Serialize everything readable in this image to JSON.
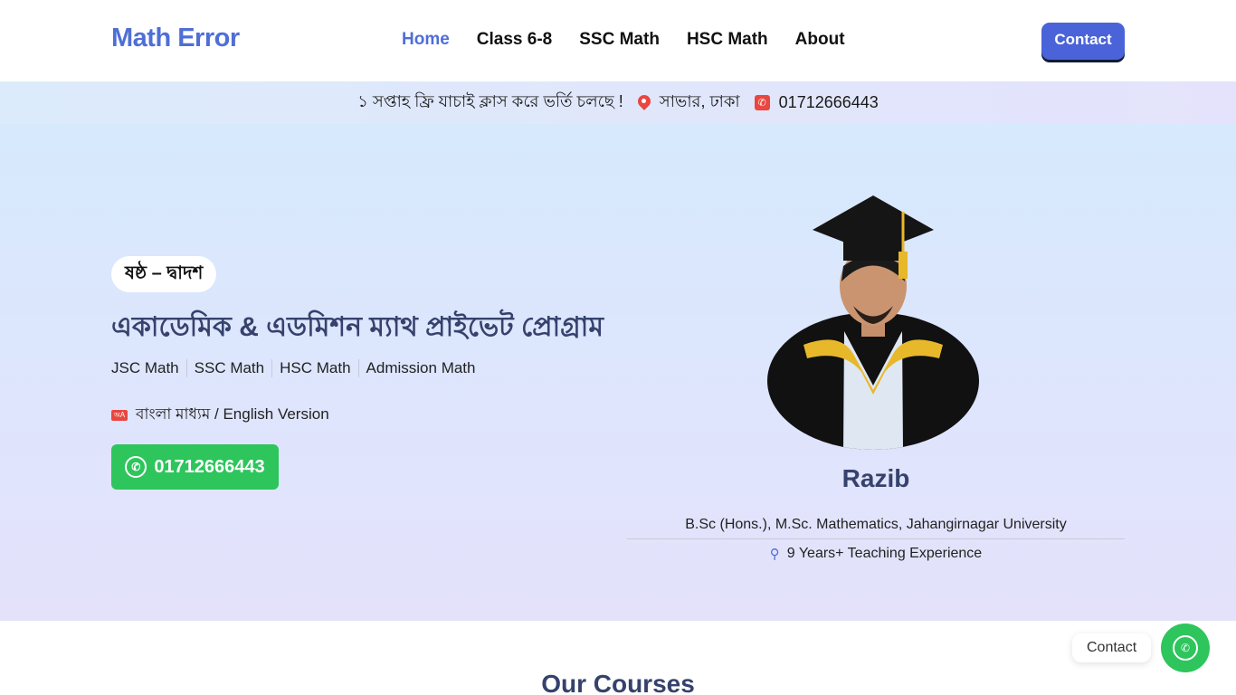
{
  "header": {
    "logo": "Math Error",
    "nav": [
      "Home",
      "Class 6-8",
      "SSC Math",
      "HSC Math",
      "About"
    ],
    "contact_label": "Contact"
  },
  "infobar": {
    "promo": "১ সপ্তাহ ফ্রি যাচাই ক্লাস করে ভর্তি চলছে !",
    "location": "সাভার, ঢাকা",
    "phone": "01712666443"
  },
  "hero": {
    "badge": "ষষ্ঠ – দ্বাদশ",
    "title": "একাডেমিক & এডমিশন ম্যাথ প্রাইভেট প্রোগ্রাম",
    "tags": [
      "JSC Math",
      "SSC Math",
      "HSC Math",
      "Admission Math"
    ],
    "medium": "বাংলা মাধ্যম / English Version",
    "whatsapp": "01712666443"
  },
  "profile": {
    "name": "Razib",
    "degree": "B.Sc (Hons.), M.Sc. Mathematics, Jahangirnagar University",
    "experience": "9 Years+ Teaching Experience"
  },
  "courses": {
    "title": "Our Courses"
  },
  "floating": {
    "label": "Contact"
  },
  "colors": {
    "brand": "#4f6ed6",
    "button": "#4a63d8",
    "whatsapp": "#2dc55c",
    "heading": "#36426d",
    "accent_red": "#e9473f"
  }
}
